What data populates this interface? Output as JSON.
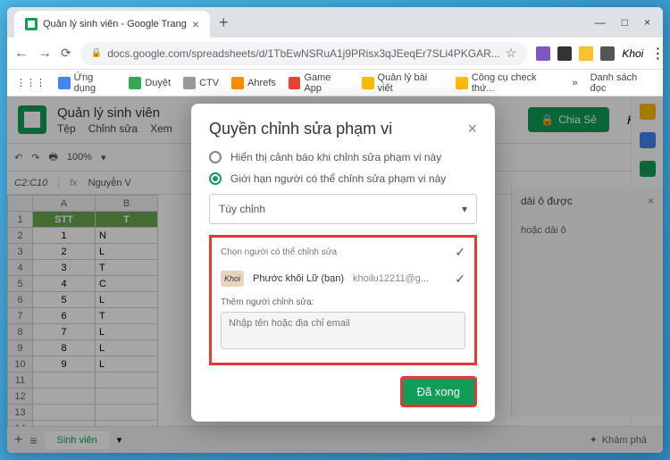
{
  "browser": {
    "tab_title": "Quản lý sinh viên - Google Trang",
    "url": "docs.google.com/spreadsheets/d/1TbEwNSRuA1j9PRisx3qJEeqEr7SLi4PKGAR...",
    "bookmarks": [
      "Ứng dụng",
      "Duyệt",
      "CTV",
      "Ahrefs",
      "Game App",
      "Quản lý bài viết",
      "Công cụ check thứ..."
    ],
    "reading_list": "Danh sách đọc"
  },
  "sheets": {
    "doc_title": "Quản lý sinh viên",
    "menus": [
      "Tệp",
      "Chỉnh sửa",
      "Xem"
    ],
    "share": "Chia Sẻ",
    "user_script": "Khoi",
    "zoom": "100%",
    "cell_ref": "C2:C10",
    "fx_value": "Nguyễn V",
    "col_stt": "STT",
    "col_b_header": "T",
    "rows": [
      "1",
      "2",
      "3",
      "4",
      "5",
      "6",
      "7",
      "8",
      "9"
    ],
    "cells_b": [
      "N",
      "L",
      "T",
      "C",
      "L",
      "T",
      "L",
      "L",
      "L"
    ],
    "sheet_tab": "Sinh viên",
    "explore": "Khám phá"
  },
  "sidepanel": {
    "title": "dài ô được",
    "sub": "hoặc dải ô"
  },
  "modal": {
    "title": "Quyền chỉnh sửa phạm vi",
    "radio1": "Hiển thị cảnh báo khi chỉnh sửa phạm vi này",
    "radio2": "Giới hạn người có thể chỉnh sửa phạm vi này",
    "select_value": "Tùy chỉnh",
    "choose_label": "Chọn người có thể chỉnh sửa",
    "avatar_text": "Khoi",
    "person_name": "Phước khôi Lữ (bạn)",
    "person_email": "khoilu12211@g...",
    "add_label": "Thêm người chỉnh sửa:",
    "add_placeholder": "Nhập tên hoặc địa chỉ email",
    "done": "Đã xong"
  }
}
